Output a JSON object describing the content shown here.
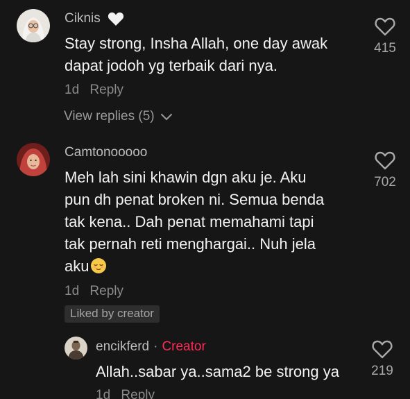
{
  "comments": [
    {
      "username": "Ciknis",
      "badge_icon": "white-heart-icon",
      "lines": [
        "Stay strong, Insha Allah, one day awak",
        "dapat jodoh yg terbaik dari nya."
      ],
      "time": "1d",
      "reply_label": "Reply",
      "likes": "415",
      "view_replies": "View replies (5)"
    },
    {
      "username": "Camtonooooo",
      "lines": [
        "Meh lah sini khawin dgn aku je. Aku",
        "pun dh penat broken ni. Semua benda",
        "tak kena.. Dah penat memahami tapi",
        "tak pernah reti menghargai.. Nuh jela",
        "aku"
      ],
      "trailing_emoji": "relieved-face-emoji",
      "time": "1d",
      "reply_label": "Reply",
      "likes": "702",
      "liked_badge": "Liked by creator"
    }
  ],
  "reply": {
    "username": "encikferd",
    "separator": "·",
    "creator_label": "Creator",
    "text": "Allah..sabar ya..sama2 be strong ya",
    "time": "1d",
    "reply_label": "Reply",
    "likes": "219"
  },
  "colors": {
    "background": "#161616",
    "creator": "#fe2c55",
    "muted": "#8a8a8a"
  }
}
